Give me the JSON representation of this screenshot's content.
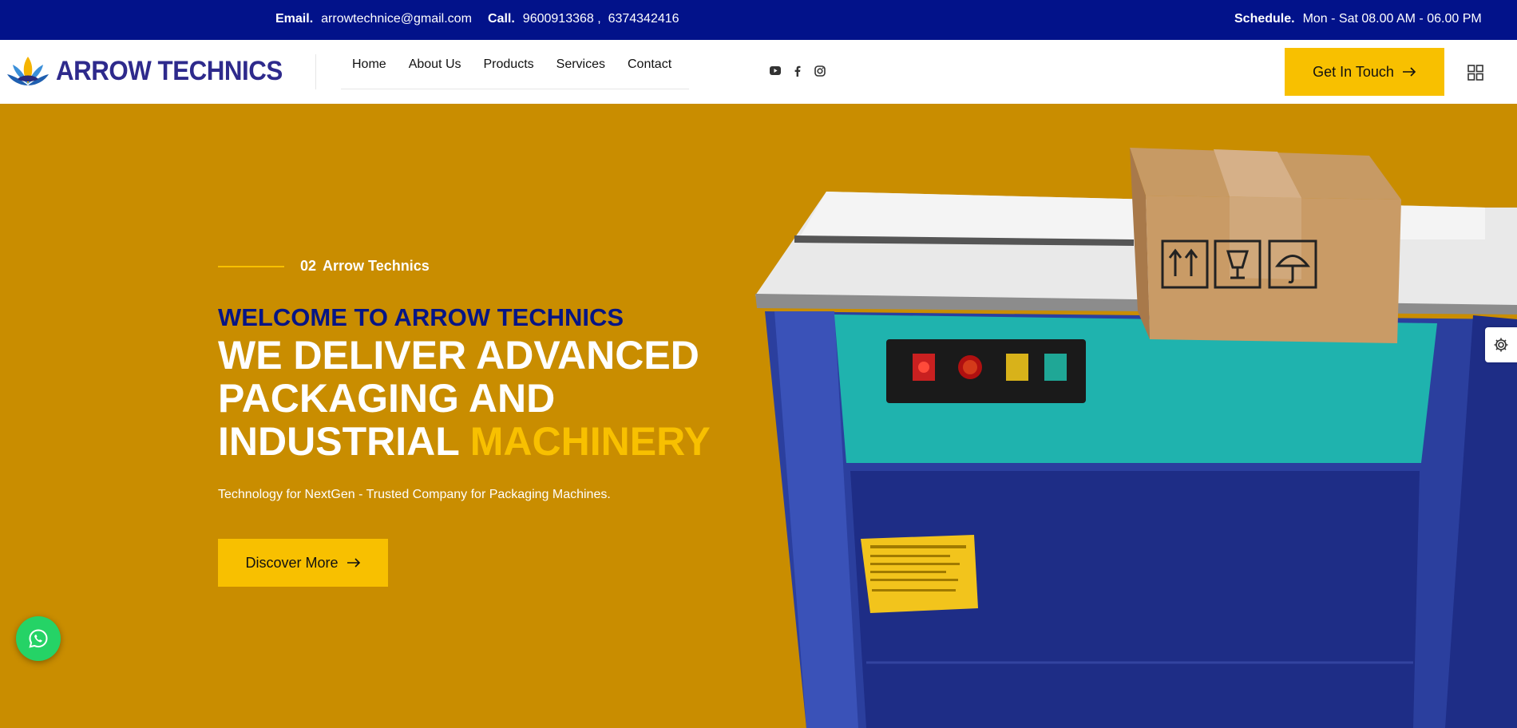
{
  "topbar": {
    "email_label": "Email.",
    "email": "arrowtechnice@gmail.com",
    "call_label": "Call.",
    "phones": "9600913368 ,  6374342416",
    "schedule_label": "Schedule.",
    "schedule": "Mon - Sat 08.00 AM - 06.00 PM"
  },
  "brand": {
    "name": "ARROW TECHNICS"
  },
  "nav": [
    {
      "label": "Home"
    },
    {
      "label": "About Us"
    },
    {
      "label": "Products"
    },
    {
      "label": "Services"
    },
    {
      "label": "Contact"
    }
  ],
  "socials": [
    "youtube-icon",
    "facebook-icon",
    "instagram-icon"
  ],
  "header": {
    "cta_label": "Get In Touch"
  },
  "hero": {
    "eyebrow_num": "02",
    "eyebrow_text": "Arrow Technics",
    "welcome": "WELCOME TO ARROW TECHNICS",
    "headline_line1": "WE DELIVER ADVANCED",
    "headline_line2": "PACKAGING AND",
    "headline_line3_plain": "INDUSTRIAL ",
    "headline_line3_accent": "MACHINERY",
    "tagline": "Technology for NextGen - Trusted Company for Packaging Machines.",
    "button_label": "Discover More"
  },
  "colors": {
    "topbar_bg": "#02128a",
    "hero_bg": "#c98d00",
    "accent_yellow": "#f8c000",
    "welcome_blue": "#061585",
    "whatsapp_green": "#25d366"
  }
}
